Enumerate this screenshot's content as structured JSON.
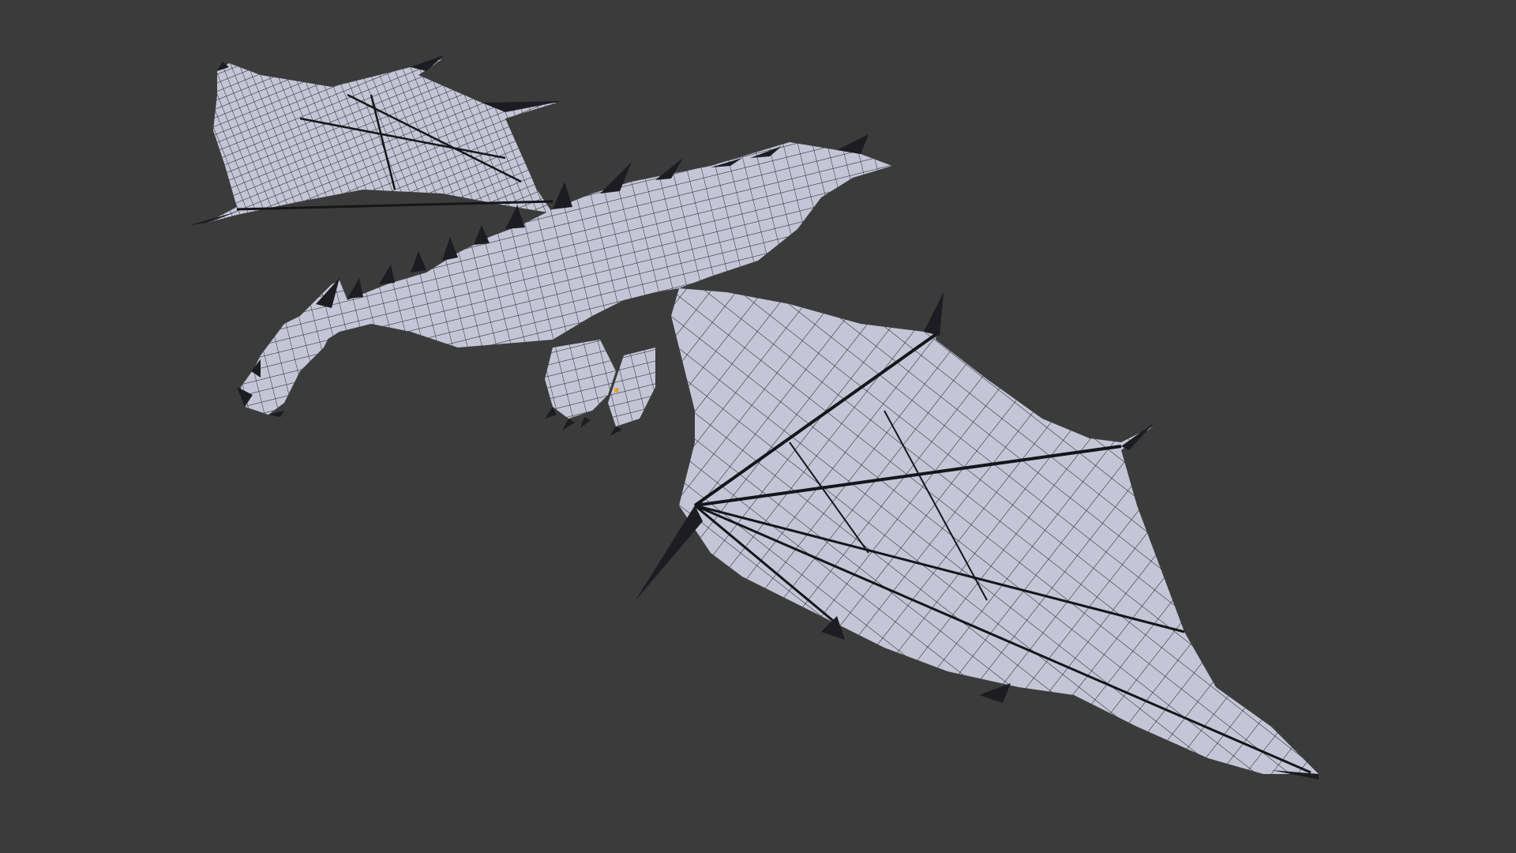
{
  "viewport": {
    "background": "#3b3b3b",
    "mesh_color": "#c4c5d6",
    "wire_color": "#15151a",
    "object": "dragon-mesh",
    "display_mode": "wireframe-overlay"
  }
}
